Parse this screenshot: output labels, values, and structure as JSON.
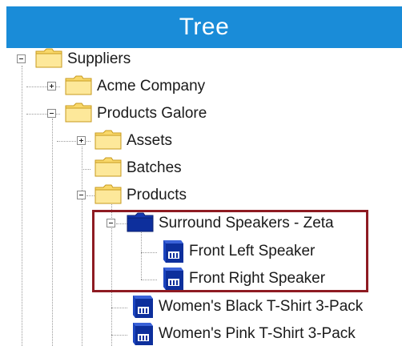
{
  "header": {
    "title": "Tree"
  },
  "tree": {
    "nodes": [
      {
        "label": "Suppliers",
        "icon": "folder-icon",
        "expander": "collapse"
      },
      {
        "label": "Acme Company",
        "icon": "folder-icon",
        "expander": "expand"
      },
      {
        "label": "Products Galore",
        "icon": "folder-icon",
        "expander": "collapse"
      },
      {
        "label": "Assets",
        "icon": "folder-icon",
        "expander": "expand"
      },
      {
        "label": "Batches",
        "icon": "folder-icon",
        "expander": "none"
      },
      {
        "label": "Products",
        "icon": "folder-icon",
        "expander": "collapse"
      },
      {
        "label": "Surround Speakers - Zeta",
        "icon": "blue-folder-icon",
        "expander": "collapse"
      },
      {
        "label": "Front Left Speaker",
        "icon": "product-cube-icon",
        "expander": "none"
      },
      {
        "label": "Front Right Speaker",
        "icon": "product-cube-icon",
        "expander": "none"
      },
      {
        "label": "Women's Black T-Shirt 3-Pack",
        "icon": "product-cube-icon",
        "expander": "none"
      },
      {
        "label": "Women's Pink T-Shirt 3-Pack",
        "icon": "product-cube-icon",
        "expander": "none"
      }
    ]
  },
  "colors": {
    "header_bg": "#1a8cd8",
    "folder_yellow": "#f9d86a",
    "folder_blue": "#0d2f9c",
    "highlight_border": "#8e1b22"
  }
}
